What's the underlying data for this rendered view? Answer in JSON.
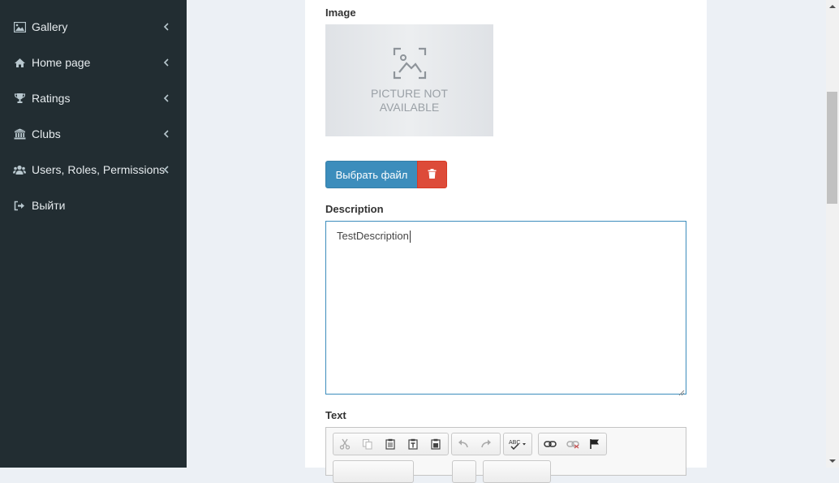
{
  "sidebar": {
    "items": [
      {
        "label": "Gallery",
        "icon": "image-icon",
        "has_chevron": true
      },
      {
        "label": "Home page",
        "icon": "home-icon",
        "has_chevron": true
      },
      {
        "label": "Ratings",
        "icon": "trophy-icon",
        "has_chevron": true
      },
      {
        "label": "Clubs",
        "icon": "bank-icon",
        "has_chevron": true
      },
      {
        "label": "Users, Roles, Permissions",
        "icon": "users-icon",
        "has_chevron": true
      },
      {
        "label": "Выйти",
        "icon": "sign-out-icon",
        "has_chevron": false
      }
    ]
  },
  "form": {
    "image_label": "Image",
    "placeholder_line1": "PICTURE NOT",
    "placeholder_line2": "AVAILABLE",
    "choose_file_label": "Выбрать файл",
    "description_label": "Description",
    "description_value": "TestDescription",
    "text_label": "Text"
  },
  "colors": {
    "sidebar_bg": "#222d32",
    "primary": "#3c8dbc",
    "danger": "#dd4b39",
    "page_bg": "#ecf0f5"
  },
  "editor_toolbar": {
    "buttons": [
      "cut-icon",
      "copy-icon",
      "paste-icon",
      "paste-text-icon",
      "paste-word-icon",
      "undo-icon",
      "redo-icon",
      "spellcheck-icon",
      "link-icon",
      "unlink-icon",
      "anchor-icon"
    ]
  }
}
